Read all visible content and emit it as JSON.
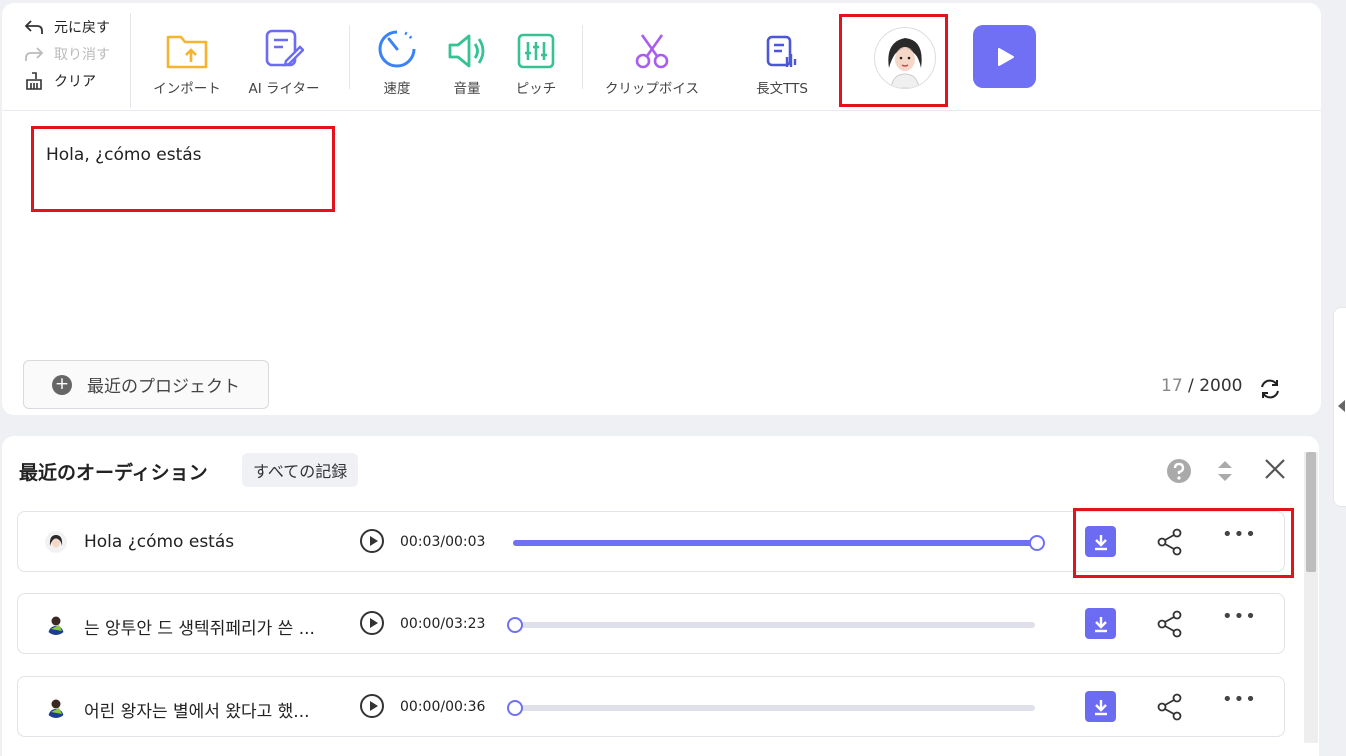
{
  "toolbar": {
    "undo": "元に戻す",
    "redo": "取り消す",
    "clear": "クリア",
    "import": "インポート",
    "ai_writer": "AI ライター",
    "speed": "速度",
    "volume": "音量",
    "pitch": "ピッチ",
    "clip_voice": "クリップボイス",
    "long_tts": "長文TTS"
  },
  "editor": {
    "text": "Hola, ¿cómo estás",
    "recent_projects": "最近のプロジェクト",
    "char_count": "17",
    "char_limit": "2000",
    "separator": "/"
  },
  "auditions": {
    "title": "最近のオーディション",
    "all_records": "すべての記録",
    "items": [
      {
        "title": "Hola ¿cómo estás",
        "time": "00:03/00:03",
        "progress": 1.0
      },
      {
        "title": "는 앙투안 드 생텍쥐페리가 쓴 ...",
        "time": "00:00/03:23",
        "progress": 0.0
      },
      {
        "title": "어린 왕자는 별에서 왔다고 했...",
        "time": "00:00/00:36",
        "progress": 0.0
      }
    ]
  },
  "colors": {
    "accent": "#7070f5",
    "highlight": "#e3131c"
  }
}
